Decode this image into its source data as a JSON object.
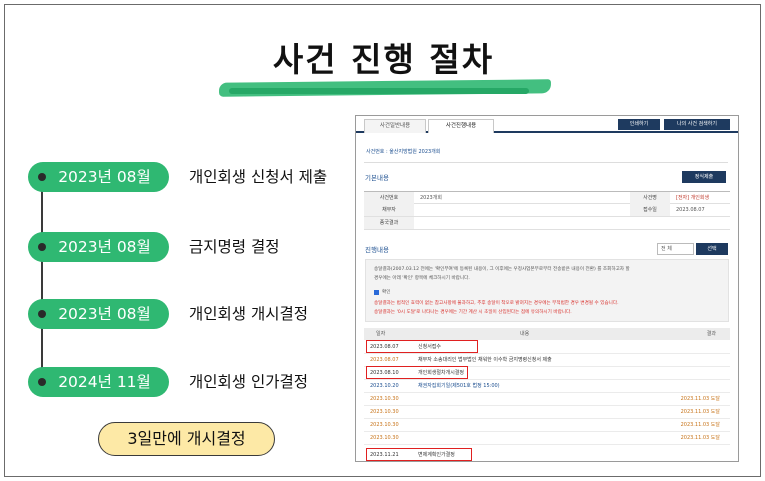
{
  "title": "사건 진행 절차",
  "timeline": [
    {
      "date": "2023년 08월",
      "event": "개인회생 신청서 제출"
    },
    {
      "date": "2023년 08월",
      "event": "금지명령 결정"
    },
    {
      "date": "2023년 08월",
      "event": "개인회생 개시결정"
    },
    {
      "date": "2024년 11월",
      "event": "개인회생 인가결정"
    }
  ],
  "note": "3일만에 개시결정",
  "screen": {
    "tabs": [
      "사건일반내용",
      "사건진행내용"
    ],
    "buttons": {
      "print": "인쇄하기",
      "my_case": "나의 사건 검색하기",
      "search": "정식제출",
      "select": "선택"
    },
    "case_no": "사건번호 : 울산지방법원 2023개회",
    "basic_title": "기본내용",
    "progress_title": "진행내용",
    "info": [
      {
        "label1": "사건번호",
        "value1": "2023개회",
        "label2": "사건명",
        "value2": "[전자] 개인회생"
      },
      {
        "label1": "채무자",
        "value1": "",
        "label2": "접수일",
        "value2": "2023.08.07"
      },
      {
        "label1": "종국결과",
        "value1": "",
        "label2": "",
        "value2": ""
      }
    ],
    "filter": "전 체",
    "notice": [
      "송달결과(2007.03.12 전에는 '확인부여'에 등록된 내용이, 그 이후에는 우정사업본부로부터 전송받은 내용이 전환) 를 조회하고자 할",
      "경우에는 아래 '확인' 항목에 체크하시기 바랍니다.",
      "확인",
      "송달결과는 법적인 효력이 없는 참고사항에 불과하고, 추후 송달이 착오로 밝혀지는 경우에는 부적법한 경우 변경될 수 있습니다.",
      "송달결과는 '0시 도달'로 나타나는 경우에는 기간 계산 시 초일이 산입된다는 점에 유의하시기 바랍니다."
    ],
    "table_headers": [
      "일자",
      "내용",
      "결과"
    ],
    "rows": [
      {
        "date": "2023.08.07",
        "content": "신청서접수",
        "result": ""
      },
      {
        "date": "2023.08.07",
        "content": "채무자 소송대리인 법무법인 채워한 이수학 금지명령신청서 제출",
        "result": ""
      },
      {
        "date": "2023.08.10",
        "content": "개인회생절차개시결정",
        "result": ""
      },
      {
        "date": "2023.10.20",
        "content": "채권자집회기일(제501호 법정 15:00)",
        "result": ""
      },
      {
        "date": "2023.10.30",
        "content": "",
        "result": "2023.11.03 도달"
      },
      {
        "date": "2023.10.30",
        "content": "",
        "result": "2023.11.03 도달"
      },
      {
        "date": "2023.10.30",
        "content": "",
        "result": "2023.11.03 도달"
      },
      {
        "date": "2023.10.30",
        "content": "",
        "result": "2023.11.03 도달"
      },
      {
        "date": "2023.11.21",
        "content": "변제계획인가결정",
        "result": ""
      }
    ]
  }
}
